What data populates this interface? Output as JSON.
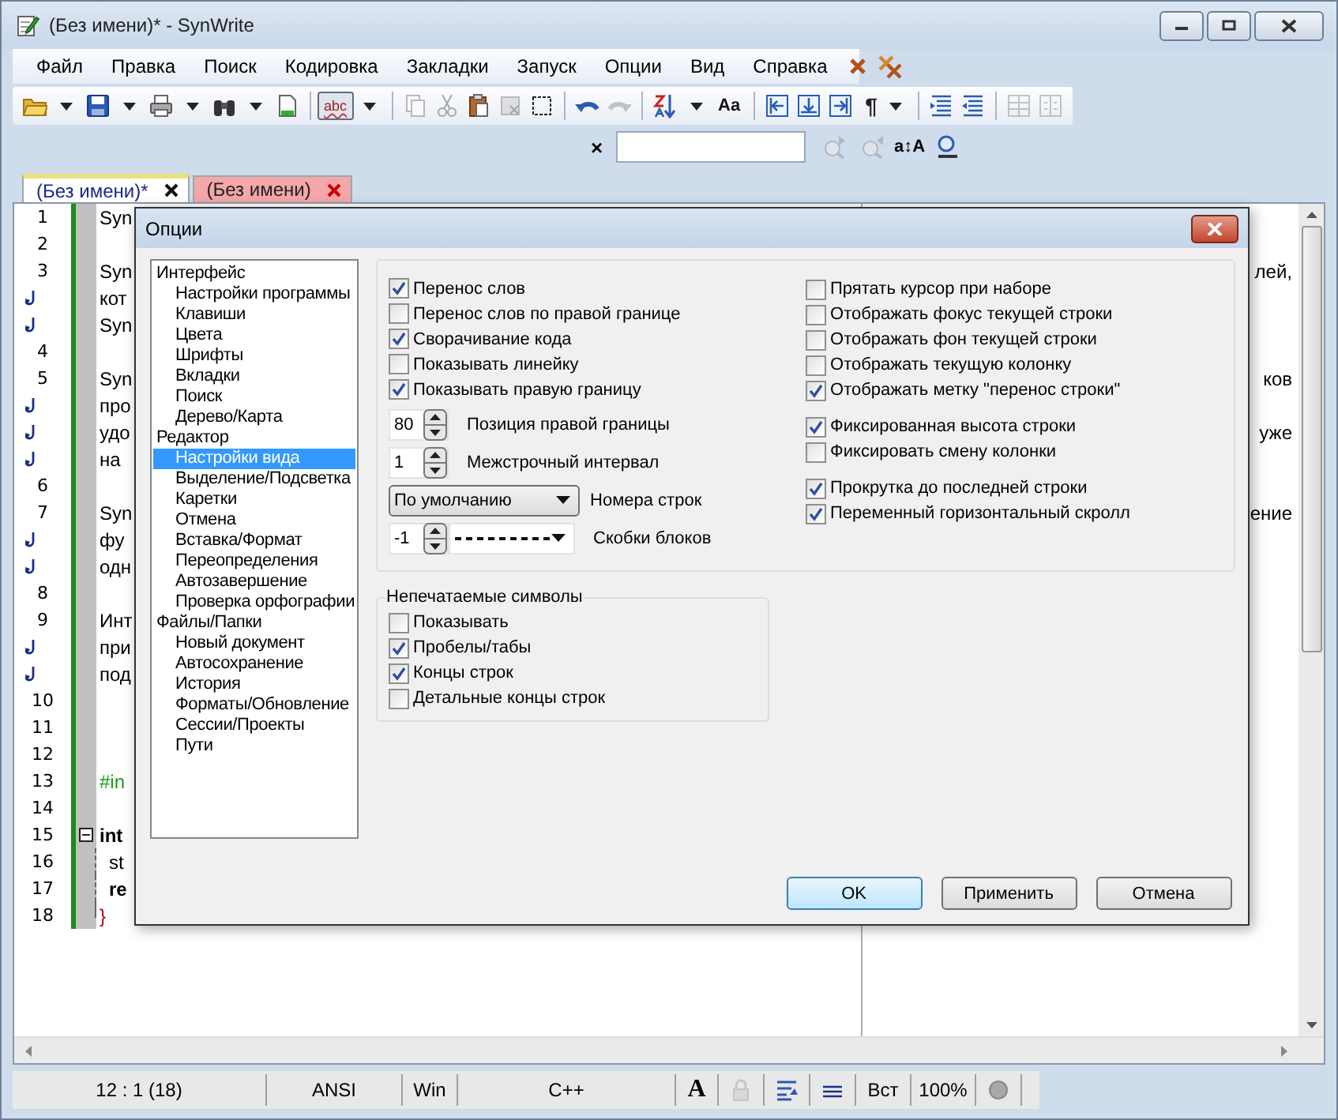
{
  "window": {
    "title": "(Без имени)* - SynWrite"
  },
  "menu": [
    "Файл",
    "Правка",
    "Поиск",
    "Кодировка",
    "Закладки",
    "Запуск",
    "Опции",
    "Вид",
    "Справка"
  ],
  "toolbar": {
    "spell_button": "abc",
    "case_button": "Aa",
    "paragraph_button": "¶"
  },
  "search_bar": {
    "close": "×",
    "case_toggle": "a↕A"
  },
  "tabs": [
    {
      "label": "(Без имени)*",
      "selected": true
    },
    {
      "label": "(Без имени)",
      "selected": false
    }
  ],
  "editor": {
    "rows": [
      {
        "kind": "line",
        "number": "1",
        "left": "Syn"
      },
      {
        "kind": "line",
        "number": "2"
      },
      {
        "kind": "line",
        "number": "3",
        "left": "Syn",
        "right": "лей,"
      },
      {
        "kind": "wrap",
        "left": "кот"
      },
      {
        "kind": "wrap",
        "left": "Syn"
      },
      {
        "kind": "line",
        "number": "4"
      },
      {
        "kind": "line",
        "number": "5",
        "left": "Syn",
        "right": "ков"
      },
      {
        "kind": "wrap",
        "left": "про"
      },
      {
        "kind": "wrap",
        "left": "удо",
        "right": "уже"
      },
      {
        "kind": "wrap",
        "left": "на"
      },
      {
        "kind": "line",
        "number": "6"
      },
      {
        "kind": "line",
        "number": "7",
        "left": "Syn",
        "right": "ение"
      },
      {
        "kind": "wrap",
        "left": "фу"
      },
      {
        "kind": "wrap",
        "left": "одн"
      },
      {
        "kind": "line",
        "number": "8"
      },
      {
        "kind": "line",
        "number": "9",
        "left": "Инт"
      },
      {
        "kind": "wrap",
        "left": "при"
      },
      {
        "kind": "wrap",
        "left": "под"
      },
      {
        "kind": "line",
        "number": "10"
      },
      {
        "kind": "line",
        "number": "11"
      },
      {
        "kind": "line",
        "number": "12"
      },
      {
        "kind": "line",
        "number": "13",
        "left": "#in"
      },
      {
        "kind": "line",
        "number": "14"
      },
      {
        "kind": "line",
        "number": "15",
        "left": "int",
        "expanded": true
      },
      {
        "kind": "line",
        "number": "16",
        "left": "st"
      },
      {
        "kind": "line",
        "number": "17",
        "left": "re"
      },
      {
        "kind": "line",
        "number": "18",
        "left": "}"
      }
    ]
  },
  "dialog": {
    "title": "Опции",
    "tree": [
      {
        "label": "Интерфейс",
        "selected": false,
        "children": [
          {
            "label": "Настройки программы",
            "selected": false
          },
          {
            "label": "Клавиши",
            "selected": false
          },
          {
            "label": "Цвета",
            "selected": false
          },
          {
            "label": "Шрифты",
            "selected": false
          },
          {
            "label": "Вкладки",
            "selected": false
          },
          {
            "label": "Поиск",
            "selected": false
          },
          {
            "label": "Дерево/Карта",
            "selected": false
          }
        ]
      },
      {
        "label": "Редактор",
        "selected": false,
        "children": [
          {
            "label": "Настройки вида",
            "selected": true
          },
          {
            "label": "Выделение/Подсветка",
            "selected": false
          },
          {
            "label": "Каретки",
            "selected": false
          },
          {
            "label": "Отмена",
            "selected": false
          },
          {
            "label": "Вставка/Формат",
            "selected": false
          },
          {
            "label": "Переопределения",
            "selected": false
          },
          {
            "label": "Автозавершение",
            "selected": false
          },
          {
            "label": "Проверка орфографии",
            "selected": false
          }
        ]
      },
      {
        "label": "Файлы/Папки",
        "selected": false,
        "children": [
          {
            "label": "Новый документ",
            "selected": false
          },
          {
            "label": "Автосохранение",
            "selected": false
          },
          {
            "label": "История",
            "selected": false
          },
          {
            "label": "Форматы/Обновление",
            "selected": false
          },
          {
            "label": "Сессии/Проекты",
            "selected": false
          },
          {
            "label": "Пути",
            "selected": false
          }
        ]
      }
    ],
    "left_options": [
      {
        "label": "Перенос слов",
        "checked": true
      },
      {
        "label": "Перенос слов по правой границе",
        "checked": false
      },
      {
        "label": "Сворачивание кода",
        "checked": true
      },
      {
        "label": "Показывать линейку",
        "checked": false
      },
      {
        "label": "Показывать правую границу",
        "checked": true
      }
    ],
    "fields": [
      {
        "kind": "spin",
        "value": "80",
        "label": "Позиция правой границы"
      },
      {
        "kind": "spin",
        "value": "1",
        "label": "Межстрочный интервал"
      },
      {
        "kind": "select",
        "choice": "По умолчанию",
        "label": "Номера строк"
      },
      {
        "kind": "spin_style",
        "value": "-1",
        "label": "Скобки блоков"
      }
    ],
    "right_groups": [
      [
        {
          "label": "Прятать курсор при наборе",
          "checked": false
        },
        {
          "label": "Отображать фокус текущей строки",
          "checked": false
        },
        {
          "label": "Отображать фон текущей строки",
          "checked": false
        },
        {
          "label": "Отображать текущую колонку",
          "checked": false
        },
        {
          "label": "Отображать метку \"перенос строки\"",
          "checked": true
        }
      ],
      [
        {
          "label": "Фиксированная высота строки",
          "checked": true
        },
        {
          "label": "Фиксировать смену колонки",
          "checked": false
        }
      ],
      [
        {
          "label": "Прокрутка до последней строки",
          "checked": true
        },
        {
          "label": "Переменный горизонтальный скролл",
          "checked": true
        }
      ]
    ],
    "nonprinting": {
      "title": "Непечатаемые символы",
      "options": [
        {
          "label": "Показывать",
          "checked": false
        },
        {
          "label": "Пробелы/табы",
          "checked": true
        },
        {
          "label": "Концы строк",
          "checked": true
        },
        {
          "label": "Детальные концы строк",
          "checked": false
        }
      ]
    },
    "buttons": [
      {
        "label": "OK",
        "default": true
      },
      {
        "label": "Применить",
        "default": false
      },
      {
        "label": "Отмена",
        "default": false
      }
    ]
  },
  "status_bar": {
    "position": "12 : 1 (18)",
    "encoding": "ANSI",
    "line_ends": "Win",
    "lexer": "C++",
    "font": "A",
    "insert_mode": "Вст",
    "zoom": "100%"
  }
}
